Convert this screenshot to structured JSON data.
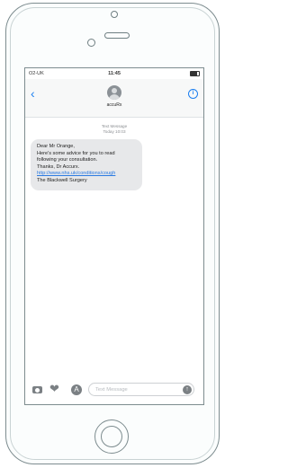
{
  "status_bar": {
    "carrier": "O2-UK",
    "time": "11:45"
  },
  "header": {
    "back_icon": "chevron-left-icon",
    "contact_name": "accuRx",
    "info_icon": "info-icon"
  },
  "thread": {
    "message_type": "Text Message",
    "timestamp": "Today 10:03"
  },
  "message": {
    "line1": "Dear Mr Orange,",
    "line2": "Here's some advice for you to read",
    "line3": "following your consultation.",
    "line4": "Thanks, Dr Accurx.",
    "link": "http://www.nhs.uk/conditions/cough",
    "line6": "The Blackwell Surgery"
  },
  "composer": {
    "placeholder": "Text Message"
  },
  "colors": {
    "ios_blue": "#1b7ff0",
    "bubble_grey": "#e7e8ea",
    "outline": "#7d8c8f"
  }
}
